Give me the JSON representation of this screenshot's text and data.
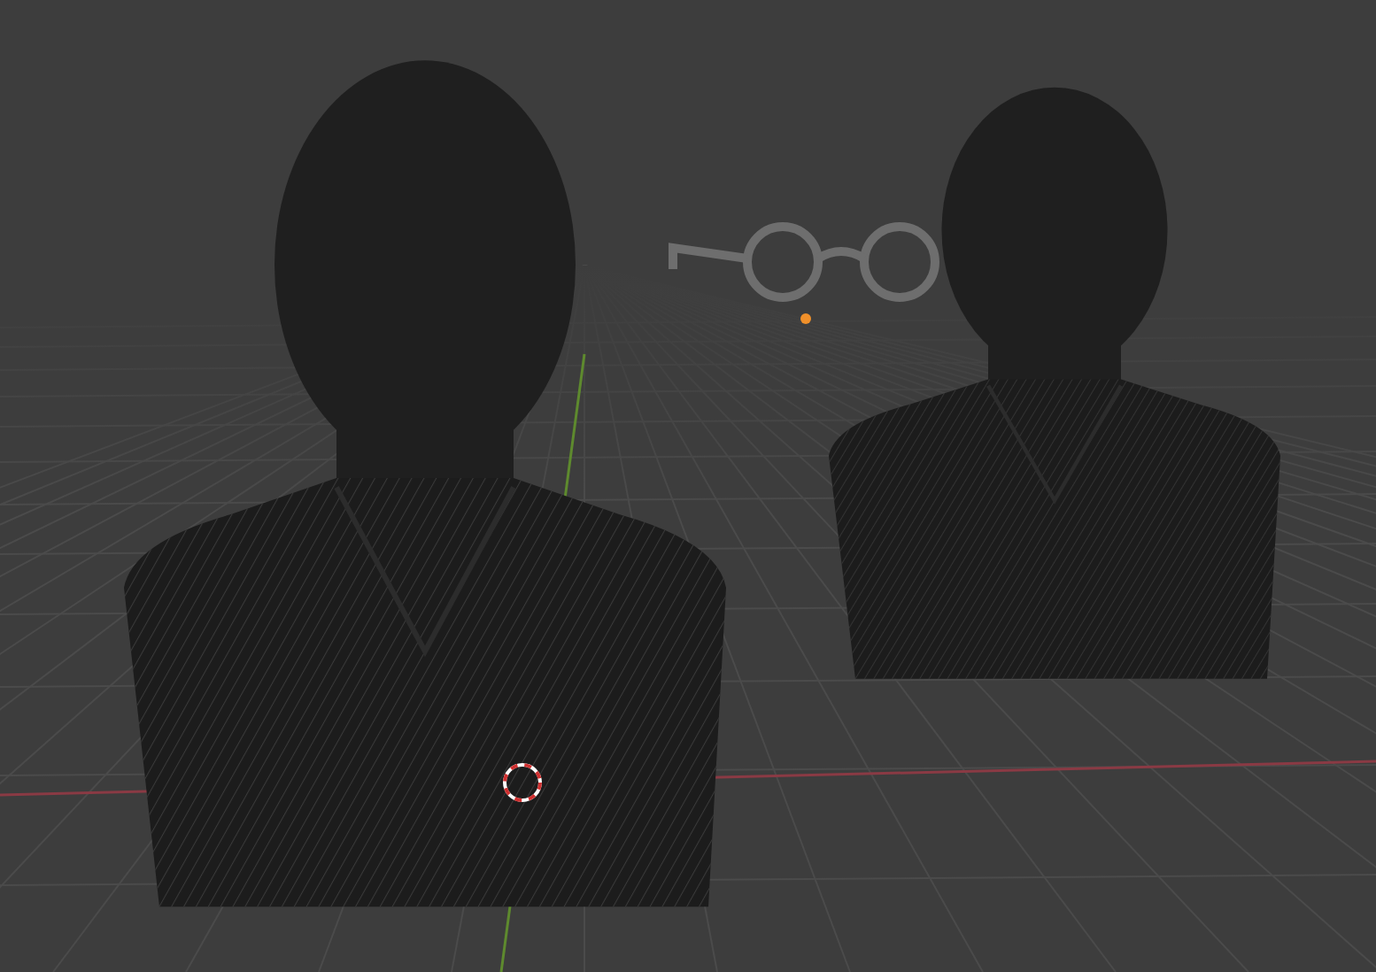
{
  "viewport": {
    "objects": [
      {
        "kind": "bust",
        "selected": false
      },
      {
        "kind": "glasses",
        "selected": true
      },
      {
        "kind": "bust",
        "selected": false
      }
    ]
  }
}
